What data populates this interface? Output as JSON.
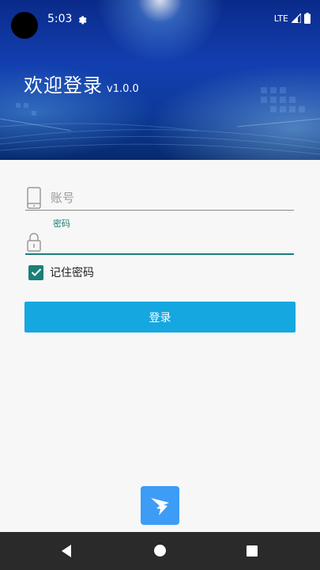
{
  "status_bar": {
    "time": "5:03",
    "network": "LTE"
  },
  "header": {
    "title": "欢迎登录",
    "version": "v1.0.0"
  },
  "form": {
    "account_placeholder": "账号",
    "account_value": "",
    "password_label": "密码",
    "password_value": "",
    "remember_label": "记住密码",
    "remember_checked": true,
    "login_button": "登录"
  },
  "colors": {
    "accent": "#1b7f78",
    "button": "#15a7df",
    "logo": "#3d9cf5"
  }
}
